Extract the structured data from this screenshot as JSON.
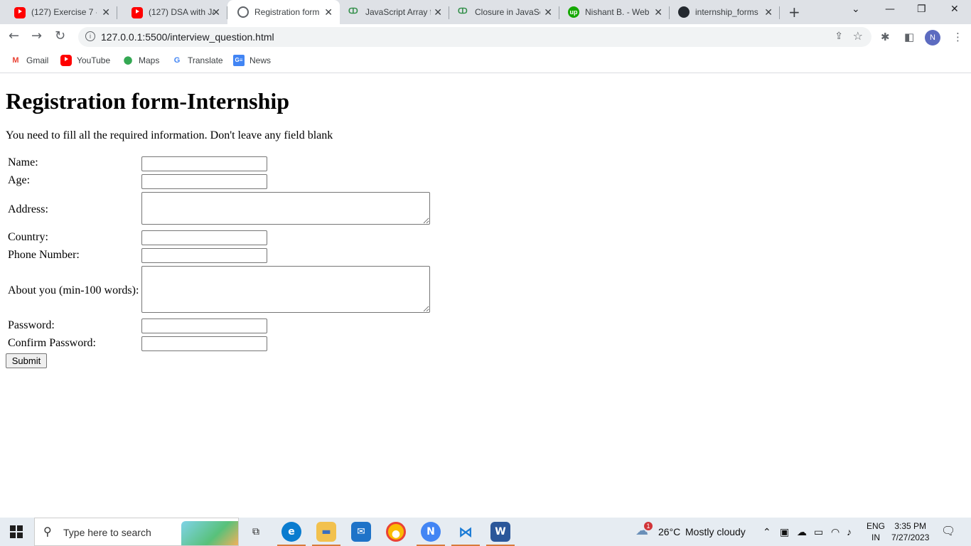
{
  "tabs": [
    {
      "title": "(127) Exercise 7 - ",
      "icon": "youtube-icon"
    },
    {
      "title": "(127) DSA with Ja",
      "icon": "youtube-icon"
    },
    {
      "title": "Registration form",
      "icon": "globe-icon"
    },
    {
      "title": "JavaScript Array f",
      "icon": "geeksforgeeks-icon"
    },
    {
      "title": "Closure in JavaSc",
      "icon": "geeksforgeeks-icon"
    },
    {
      "title": "Nishant B. - Web",
      "icon": "upwork-icon"
    },
    {
      "title": "internship_forms",
      "icon": "github-icon"
    }
  ],
  "address_bar": {
    "url": "127.0.0.1:5500/interview_question.html"
  },
  "profile": {
    "initial": "N"
  },
  "bookmarks": [
    {
      "label": "Gmail",
      "icon": "gmail-icon"
    },
    {
      "label": "YouTube",
      "icon": "youtube-icon"
    },
    {
      "label": "Maps",
      "icon": "maps-icon"
    },
    {
      "label": "Translate",
      "icon": "translate-icon"
    },
    {
      "label": "News",
      "icon": "news-icon"
    }
  ],
  "page": {
    "heading": "Registration form-Internship",
    "description": "You need to fill all the required information. Don't leave any field blank",
    "fields": {
      "name": {
        "label": "Name:",
        "value": ""
      },
      "age": {
        "label": "Age:",
        "value": ""
      },
      "address": {
        "label": "Address:",
        "value": ""
      },
      "country": {
        "label": "Country:",
        "value": ""
      },
      "phone": {
        "label": "Phone Number:",
        "value": ""
      },
      "about": {
        "label": "About you (min-100 words):",
        "value": ""
      },
      "password": {
        "label": "Password:",
        "value": ""
      },
      "confirm_password": {
        "label": "Confirm Password:",
        "value": ""
      }
    },
    "submit_label": "Submit"
  },
  "taskbar": {
    "search_placeholder": "Type here to search",
    "weather": {
      "temp": "26°C",
      "condition": "Mostly cloudy",
      "badge": "1"
    },
    "language": {
      "line1": "ENG",
      "line2": "IN"
    },
    "clock": {
      "time": "3:35 PM",
      "date": "7/27/2023"
    }
  },
  "colors": {
    "tab_strip": "#dee1e6",
    "taskbar": "#e6ecf2",
    "profile": "#5c6bc0"
  }
}
